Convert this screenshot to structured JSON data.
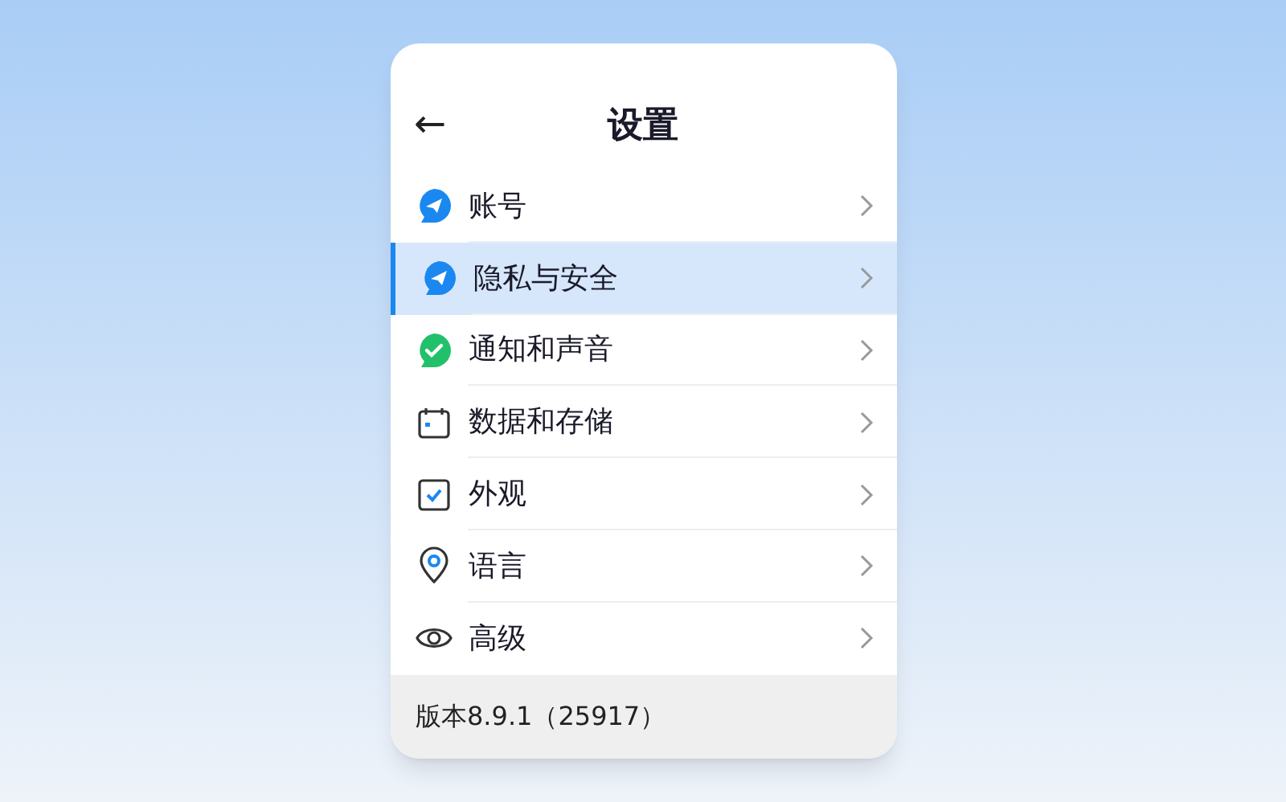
{
  "header": {
    "back": "←",
    "title": "设置"
  },
  "items": [
    {
      "label": "账号",
      "selected": false
    },
    {
      "label": "隐私与安全",
      "selected": true
    },
    {
      "label": "通知和声音",
      "selected": false
    },
    {
      "label": "数据和存储",
      "selected": false
    },
    {
      "label": "外观",
      "selected": false
    },
    {
      "label": "语言",
      "selected": false
    },
    {
      "label": "高级",
      "selected": false
    }
  ],
  "footer": {
    "version": "版本8.9.1（25917）"
  }
}
